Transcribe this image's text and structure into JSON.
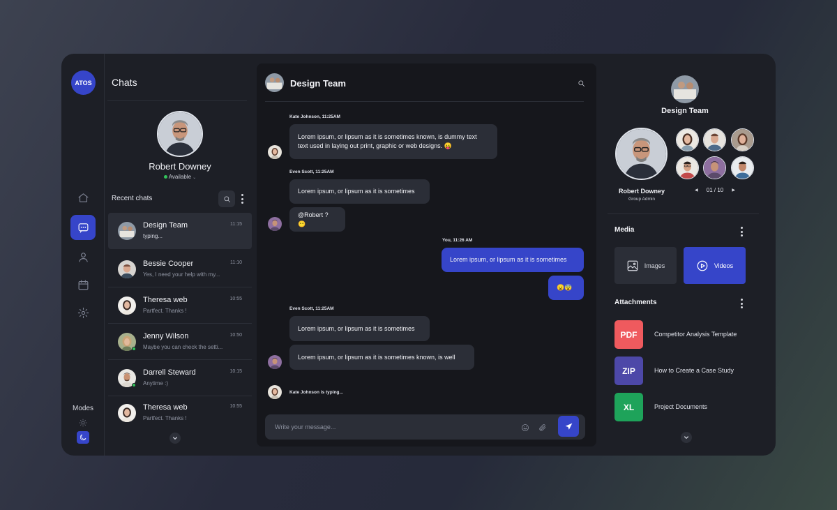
{
  "brand": {
    "logo_text": "ATOS",
    "accent": "#3645c9"
  },
  "rail": {
    "items": [
      {
        "name": "home-icon",
        "active": false
      },
      {
        "name": "chat-icon",
        "active": true
      },
      {
        "name": "user-icon",
        "active": false
      },
      {
        "name": "calendar-icon",
        "active": false
      },
      {
        "name": "settings-icon",
        "active": false
      }
    ],
    "modes_label": "Modes"
  },
  "chats": {
    "title": "Chats",
    "profile": {
      "name": "Robert Downey",
      "status": "Available"
    },
    "recent_label": "Recent chats",
    "items": [
      {
        "name": "Design Team",
        "preview": "typing...",
        "time": "11:15",
        "active": true,
        "online": false
      },
      {
        "name": "Bessie Cooper",
        "preview": "Yes, I need your help with my...",
        "time": "11:10",
        "active": false,
        "online": false
      },
      {
        "name": "Theresa web",
        "preview": "Partfect. Thanks !",
        "time": "10:55",
        "active": false,
        "online": false
      },
      {
        "name": "Jenny Wilson",
        "preview": "Maybe you can check the setti...",
        "time": "10:50",
        "active": false,
        "online": true
      },
      {
        "name": "Darrell Steward",
        "preview": "Anytime :)",
        "time": "10:15",
        "active": false,
        "online": true
      },
      {
        "name": "Theresa web",
        "preview": "Partfect. Thanks !",
        "time": "10:55",
        "active": false,
        "online": false
      }
    ]
  },
  "conversation": {
    "title": "Design Team",
    "messages": [
      {
        "meta": "Kate Johnson, 11:25AM",
        "text_1": "Lorem ipsum, or lipsum as it is sometimes known, is dummy text",
        "text_2": "text used in laying out print, graphic or web designs. 😛"
      },
      {
        "meta": "Even Scott, 11:25AM",
        "text_1": "Lorem ipsum, or lipsum as it is sometimes",
        "text_2": "@Robert ? 😶"
      },
      {
        "meta": "You, 11:26 AM",
        "text_1": "Lorem ipsum, or lipsum as it is sometimes",
        "text_2": "😦😨"
      },
      {
        "meta": "Even Scott, 11:25AM",
        "text_1": "Lorem ipsum, or lipsum as it is sometimes",
        "text_2": "Lorem ipsum, or lipsum as it is sometimes known, is well"
      }
    ],
    "typing_text": "Kate Johnson is typing...",
    "composer_placeholder": "Write your message..."
  },
  "details": {
    "group_name": "Design Team",
    "admin": {
      "name": "Robert Downey",
      "role": "Group Admin"
    },
    "pager": "01 / 10",
    "media_title": "Media",
    "media_buttons": {
      "images": "Images",
      "videos": "Videos"
    },
    "attachments_title": "Attachments",
    "attachments": [
      {
        "type": "PDF",
        "name": "Competitor Analysis Template",
        "color": "#ef5a5e"
      },
      {
        "type": "ZIP",
        "name": "How to Create a Case Study",
        "color": "#4d48a8"
      },
      {
        "type": "XL",
        "name": "Project Documents",
        "color": "#1ea35a"
      }
    ]
  }
}
